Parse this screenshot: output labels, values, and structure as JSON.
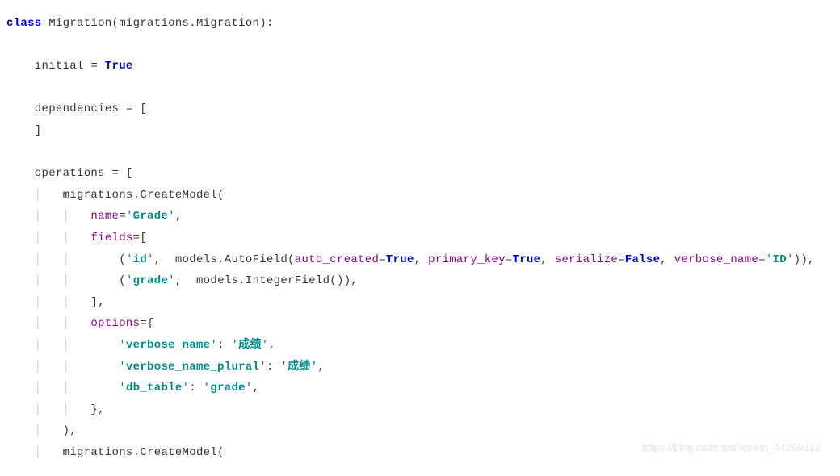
{
  "code": {
    "kw_class": "class",
    "class_decl": " Migration(migrations.Migration):",
    "initial_lhs": "    initial = ",
    "true": "True",
    "false": "False",
    "dependencies_open": "    dependencies = [",
    "dependencies_close": "    ]",
    "operations_open": "    operations = [",
    "guide2": "    │   ",
    "guide3": "    │   │   ",
    "create_model_1": "migrations.CreateModel(",
    "name_eq": "name",
    "eq": "=",
    "q": "'",
    "grade_str": "Grade",
    "comma": ",",
    "fields_eq": "fields",
    "bracket_open": "[",
    "bracket_close": "]",
    "paren_open": "(",
    "paren_close": ")",
    "id_str": "id",
    "comma_sp": ", ",
    "models_auto": " models.AutoField(",
    "auto_created": "auto_created",
    "primary_key": "primary_key",
    "serialize": "serialize",
    "verbose_name_p": "verbose_name",
    "id_upper": "ID",
    "close_paren_paren": ")),",
    "grade_field": "grade",
    "models_int": " models.IntegerField()),",
    "options_eq": "options",
    "brace_open": "{",
    "brace_close": "}",
    "vn_key": "verbose_name",
    "colon_sp": ": ",
    "cn_score": "成绩",
    "vnp_key": "verbose_name_plural",
    "dbt_key": "db_table",
    "dbt_val": "grade",
    "close_model": "),",
    "create_model_2": "migrations.CreateModel("
  },
  "watermark": "https://blog.csdn.net/weixin_44269312"
}
